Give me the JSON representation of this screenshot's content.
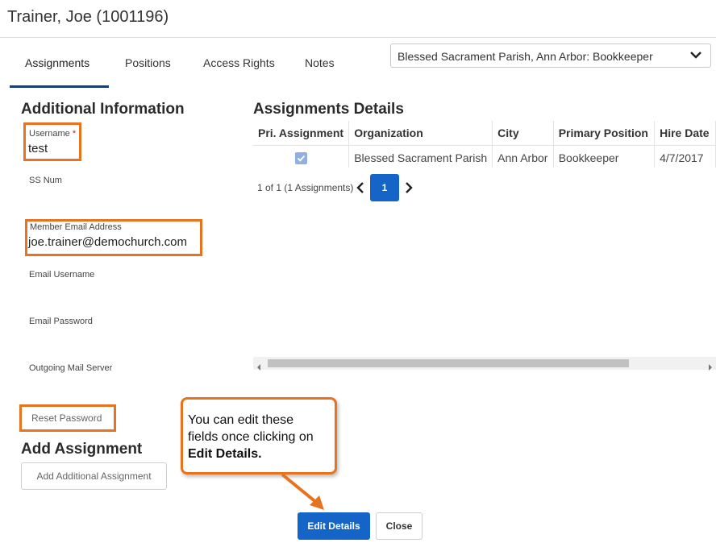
{
  "window": {
    "title": "Trainer, Joe (1001196)"
  },
  "tabs": [
    {
      "label": "Assignments",
      "active": true
    },
    {
      "label": "Positions"
    },
    {
      "label": "Access Rights"
    },
    {
      "label": "Notes"
    }
  ],
  "org_select": {
    "value": "Blessed Sacrament Parish, Ann Arbor: Bookkeeper"
  },
  "additional_info": {
    "heading": "Additional Information",
    "username": {
      "label": "Username",
      "required_mark": "*",
      "value": "test"
    },
    "ss_num": {
      "label": "SS Num"
    },
    "member_email": {
      "label": "Member Email Address",
      "value": "joe.trainer@demochurch.com"
    },
    "email_username": {
      "label": "Email Username"
    },
    "email_password": {
      "label": "Email Password"
    },
    "outgoing_mail": {
      "label": "Outgoing Mail Server"
    },
    "reset_password": "Reset Password"
  },
  "add_assignment": {
    "heading": "Add Assignment",
    "button": "Add Additional Assignment"
  },
  "assignments": {
    "heading": "Assignments Details",
    "columns": [
      "Pri. Assignment",
      "Organization",
      "City",
      "Primary Position",
      "Hire Date"
    ],
    "rows": [
      {
        "primary": true,
        "organization": "Blessed Sacrament Parish",
        "city": "Ann Arbor",
        "position": "Bookkeeper",
        "hire_date": "4/7/2017"
      }
    ],
    "pager": {
      "text": "1 of 1 (1 Assignments)",
      "current_page": "1"
    }
  },
  "callout": {
    "line1": "You can edit these",
    "line2": "fields once clicking on",
    "bold": "Edit Details."
  },
  "footer": {
    "edit": "Edit Details",
    "close": "Close"
  },
  "colors": {
    "accent": "#1565c8",
    "highlight": "#e8731f",
    "tab_underline": "#1b3f73"
  }
}
